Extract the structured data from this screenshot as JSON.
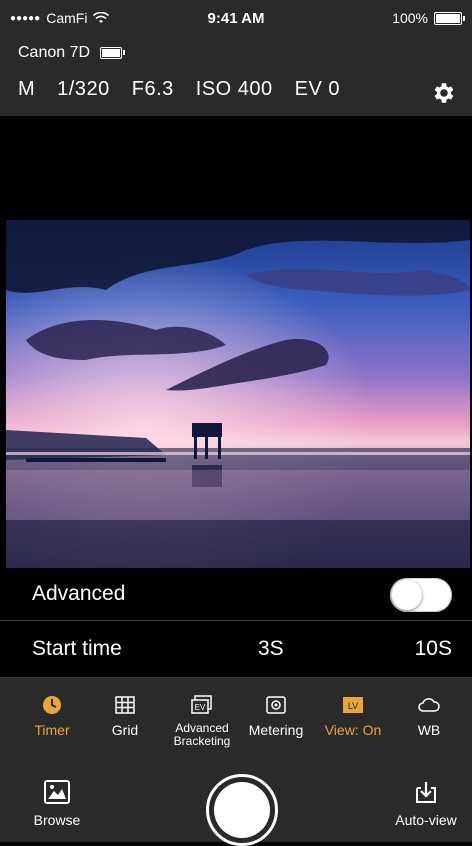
{
  "status_bar": {
    "carrier": "CamFi",
    "time": "9:41 AM",
    "battery": "100%"
  },
  "camera": {
    "name": "Canon 7D",
    "mode": "M",
    "shutter": "1/320",
    "aperture": "F6.3",
    "iso": "ISO 400",
    "ev": "EV 0"
  },
  "settings": {
    "advanced_label": "Advanced",
    "advanced_on": false,
    "start_time_label": "Start time",
    "options": [
      "3S",
      "10S"
    ]
  },
  "toolbar": {
    "items": [
      {
        "label": "Timer",
        "icon": "timer-icon",
        "active": true
      },
      {
        "label": "Grid",
        "icon": "grid-icon",
        "active": false
      },
      {
        "label": "Advanced Bracketing",
        "icon": "ev-icon",
        "active": false
      },
      {
        "label": "Metering",
        "icon": "metering-icon",
        "active": false
      },
      {
        "label": "View: On",
        "icon": "lv-icon",
        "active": true
      },
      {
        "label": "WB",
        "icon": "cloud-icon",
        "active": false
      }
    ],
    "browse_label": "Browse",
    "autoview_label": "Auto-view"
  },
  "colors": {
    "accent": "#e9a53a",
    "bar_bg": "#2a2a2a",
    "background": "#000000"
  }
}
